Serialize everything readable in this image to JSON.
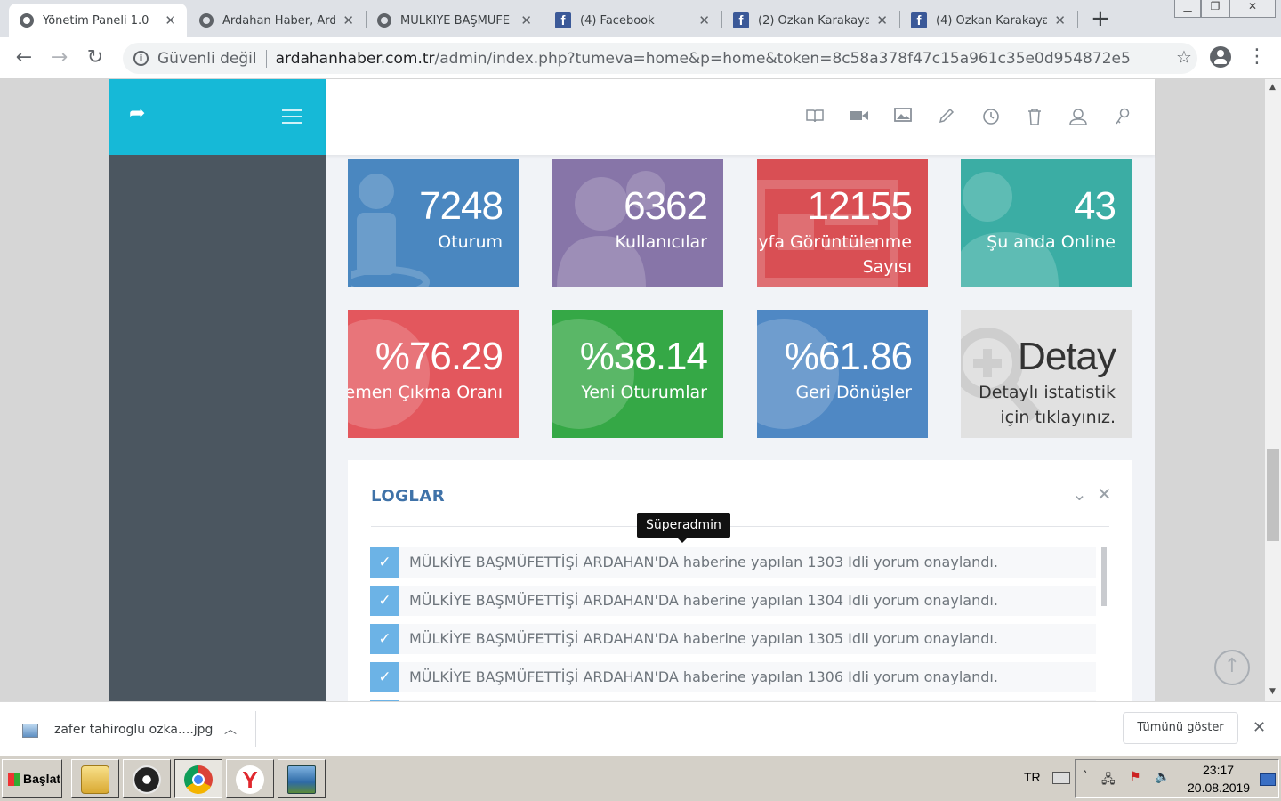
{
  "browser": {
    "tabs": [
      {
        "title": "Yönetim Paneli 1.0",
        "icon": "globe-icon",
        "active": true
      },
      {
        "title": "Ardahan Haber, Ard",
        "icon": "globe-icon",
        "active": false
      },
      {
        "title": "MÜLKİYE BAŞMÜFE",
        "icon": "globe-icon",
        "active": false
      },
      {
        "title": "(4) Facebook",
        "icon": "facebook-icon",
        "active": false
      },
      {
        "title": "(2) Özkan Karakaya",
        "icon": "facebook-icon",
        "active": false
      },
      {
        "title": "(4) Özkan Karakaya",
        "icon": "facebook-icon",
        "active": false
      }
    ],
    "tab_close": "✕",
    "new_tab": "+",
    "security_label": "Güvenli değil",
    "url_host": "ardahanhaber.com.tr",
    "url_path": "/admin/index.php?tumeva=home&p=home&token=8c58a378f47c15a961c35e0d954872e5"
  },
  "topnav_icons": [
    "book-icon",
    "video-icon",
    "image-icon",
    "pencil-icon",
    "clock-icon",
    "trash-icon",
    "user-icon",
    "key-icon"
  ],
  "stats": [
    {
      "value": "7248",
      "label": "Oturum",
      "color": "#4a87c0",
      "icon": "user-icon"
    },
    {
      "value": "6362",
      "label": "Kullanıcılar",
      "color": "#8775a8",
      "icon": "users-icon"
    },
    {
      "value": "12155",
      "label": "Sayfa Görüntülenme Sayısı",
      "color": "#d94f54",
      "icon": "browser-icon"
    },
    {
      "value": "43",
      "label": "Şu anda Online",
      "color": "#3bada4",
      "icon": "user-online-icon"
    },
    {
      "value": "%76.29",
      "label": "Hemen Çıkma Oranı",
      "color": "#e3575d",
      "icon": "globe-icon"
    },
    {
      "value": "%38.14",
      "label": "Yeni Oturumlar",
      "color": "#35a846",
      "icon": "globe-icon"
    },
    {
      "value": "%61.86",
      "label": "Geri Dönüşler",
      "color": "#4f88c4",
      "icon": "globe-icon"
    },
    {
      "value": "Detay",
      "label": "Detaylı istatistik için tıklayınız.",
      "color": "#e1e1e1",
      "icon": "zoom-in-icon"
    }
  ],
  "logs": {
    "title": "LOGLAR",
    "tooltip": "Süperadmin",
    "items": [
      "MÜLKİYE BAŞMÜFETTİŞİ ARDAHAN'DA haberine yapılan 1303 Idli yorum onaylandı.",
      "MÜLKİYE BAŞMÜFETTİŞİ ARDAHAN'DA haberine yapılan 1304 Idli yorum onaylandı.",
      "MÜLKİYE BAŞMÜFETTİŞİ ARDAHAN'DA haberine yapılan 1305 Idli yorum onaylandı.",
      "MÜLKİYE BAŞMÜFETTİŞİ ARDAHAN'DA haberine yapılan 1306 Idli yorum onaylandı."
    ]
  },
  "downloads": {
    "file": "zafer tahiroglu ozka....jpg",
    "show_all": "Tümünü göster"
  },
  "taskbar": {
    "start": "Başlat",
    "language": "TR",
    "time": "23:17",
    "date": "20.08.2019"
  }
}
